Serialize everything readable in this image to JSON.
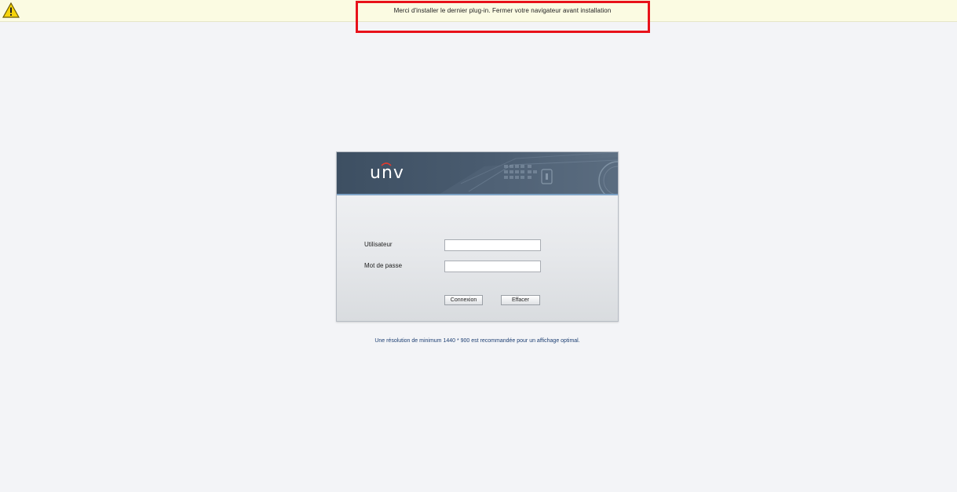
{
  "notification": {
    "message": "Merci d'installer le dernier plug-in. Fermer votre navigateur avant installation",
    "icon": "warning-icon"
  },
  "brand": {
    "logo_text": "unv"
  },
  "login": {
    "username_label": "Utilisateur",
    "username_value": "",
    "password_label": "Mot de passe",
    "password_value": "",
    "login_button": "Connexion",
    "clear_button": "Effacer"
  },
  "footer": {
    "note": "Une résolution de minimum 1440 * 900 est recommandée pour un affichage optimal."
  },
  "colors": {
    "highlight": "#e8121a",
    "notification_bg": "#fbfbe2",
    "header_bg": "#3d4f62",
    "header_accent": "#7ea3c6"
  }
}
